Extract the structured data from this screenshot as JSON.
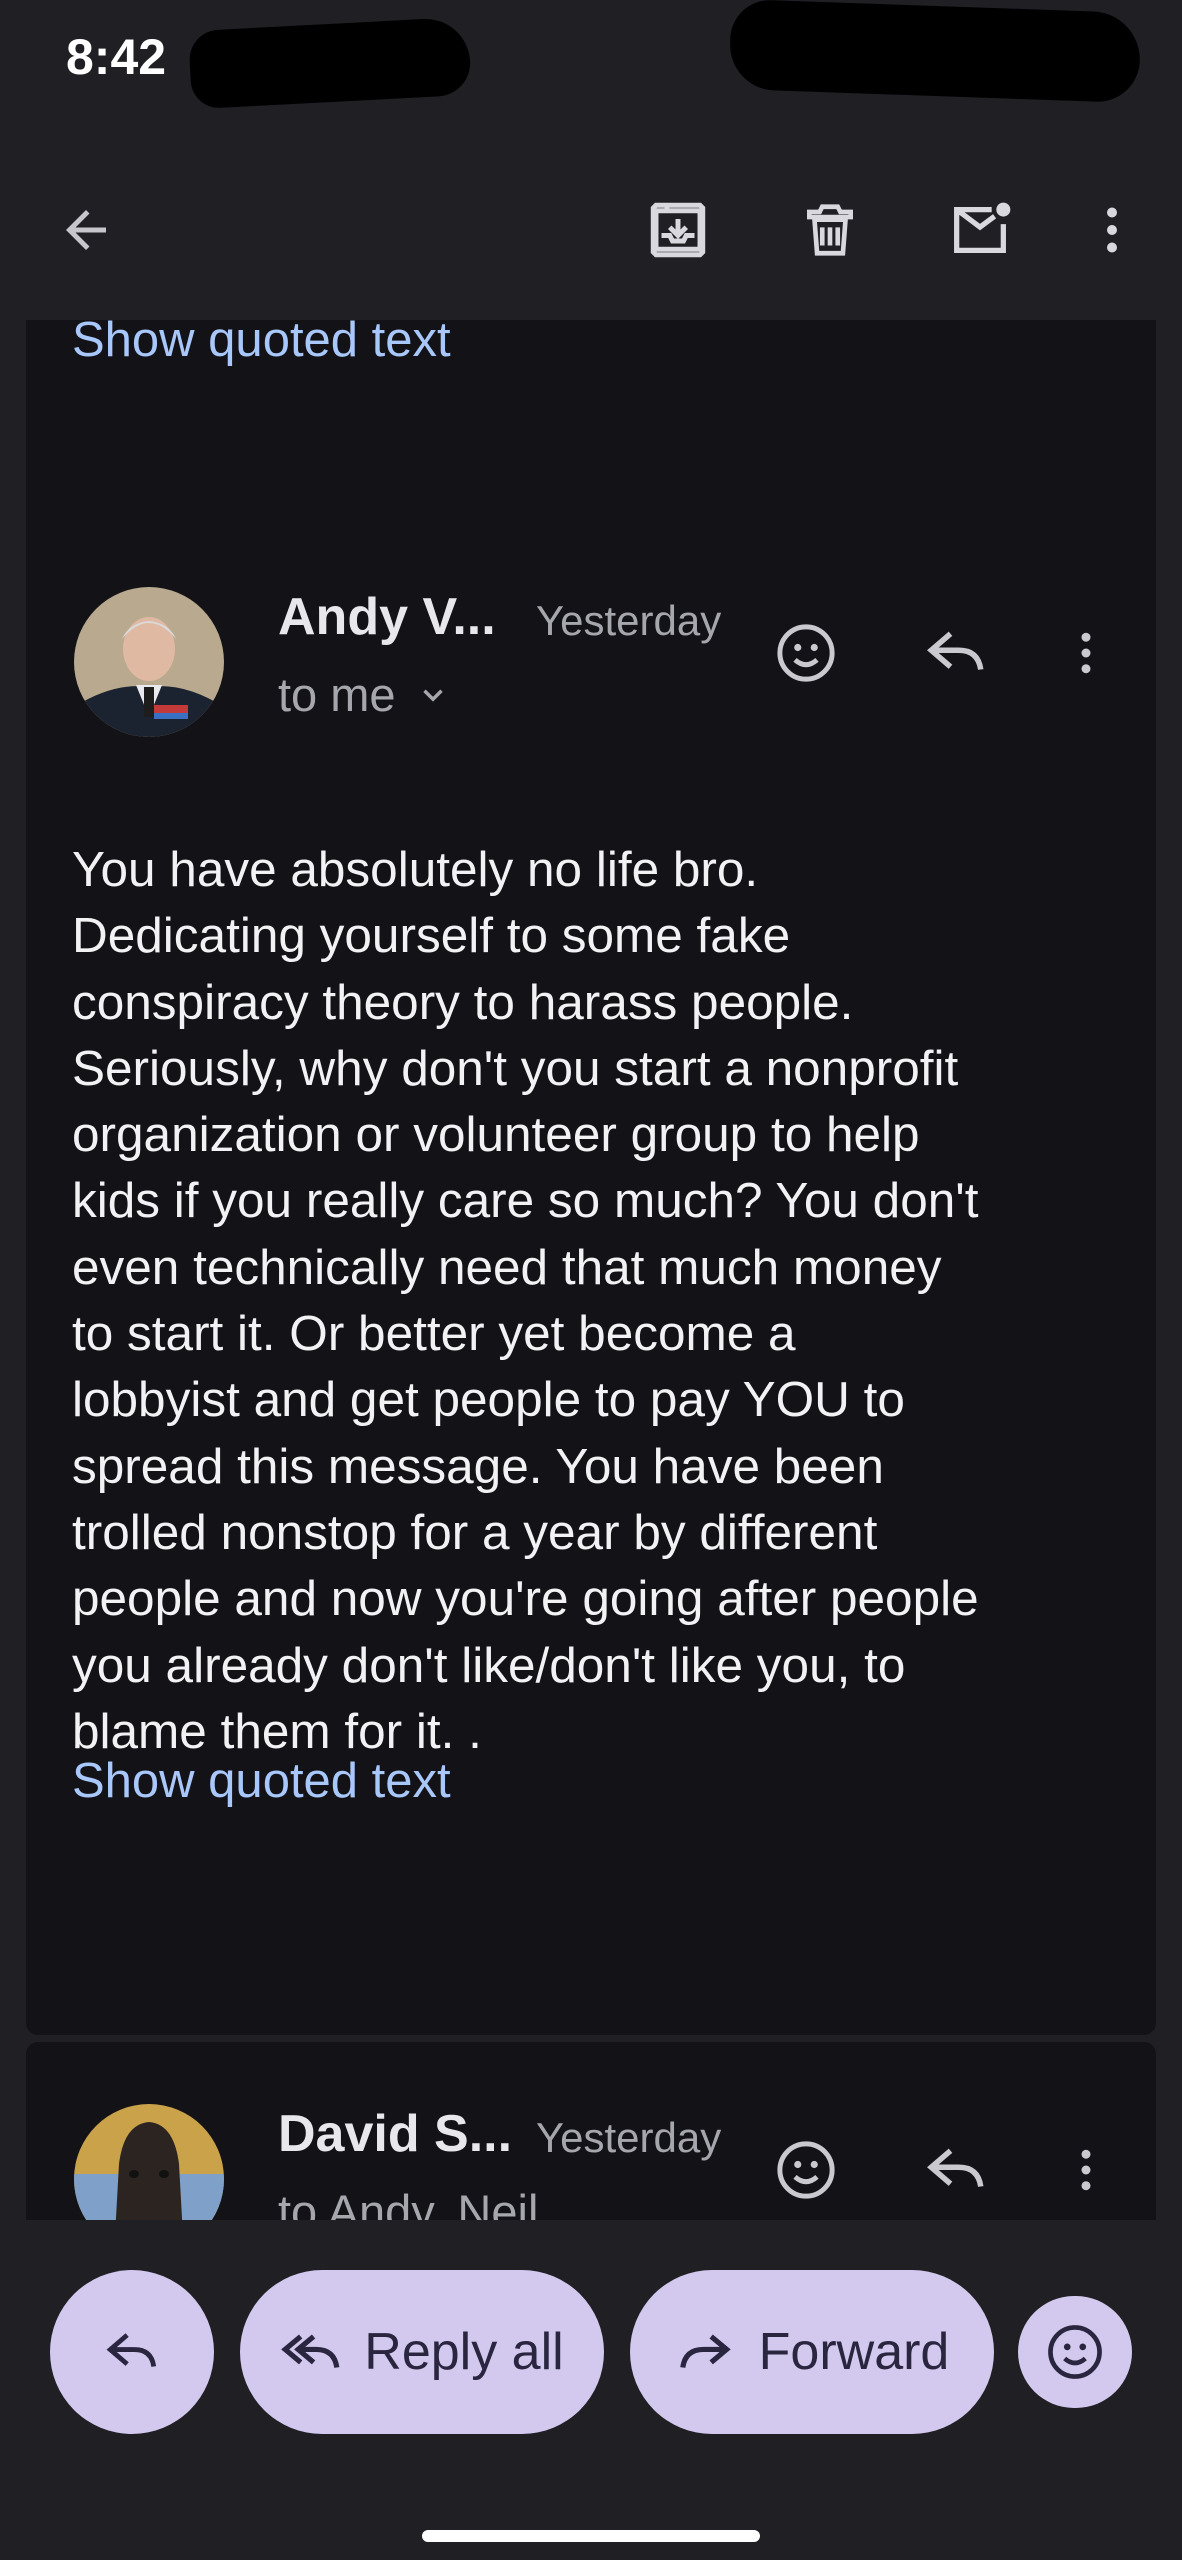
{
  "status_bar": {
    "time": "8:42"
  },
  "toolbar": {
    "back_icon": "arrow-back-icon",
    "archive_icon": "archive-icon",
    "delete_icon": "trash-icon",
    "mark_unread_icon": "mail-unread-icon",
    "more_icon": "more-vert-icon"
  },
  "thread": {
    "top_card": {
      "show_quoted": "Show quoted text"
    },
    "message": {
      "sender": "Andy V...",
      "date": "Yesterday",
      "recipients": "to me",
      "body_lines": [
        "You have absolutely no life bro.",
        "Dedicating yourself to some fake",
        "conspiracy theory to harass people.",
        "Seriously, why don't you start a nonprofit",
        "organization or volunteer group to help",
        "kids if you really care so much? You don't",
        "even technically need that much money",
        "to start it. Or better yet become a",
        "lobbyist and get people to pay YOU to",
        "spread this message. You have been",
        "trolled nonstop for a year by different",
        "people and now you're going after people",
        "you already don't like/don't like you, to",
        "blame them for it. ."
      ],
      "show_quoted": "Show quoted text"
    },
    "next_message": {
      "sender": "David S...",
      "date": "Yesterday",
      "recipients": "to Andy, Neil"
    }
  },
  "bottom_bar": {
    "reply_all_label": "Reply all",
    "forward_label": "Forward"
  },
  "colors": {
    "accent_link": "#a8c7fa",
    "pill_bg": "#d3c9ef",
    "background": "#1f1f24",
    "card_bg": "#131317"
  }
}
